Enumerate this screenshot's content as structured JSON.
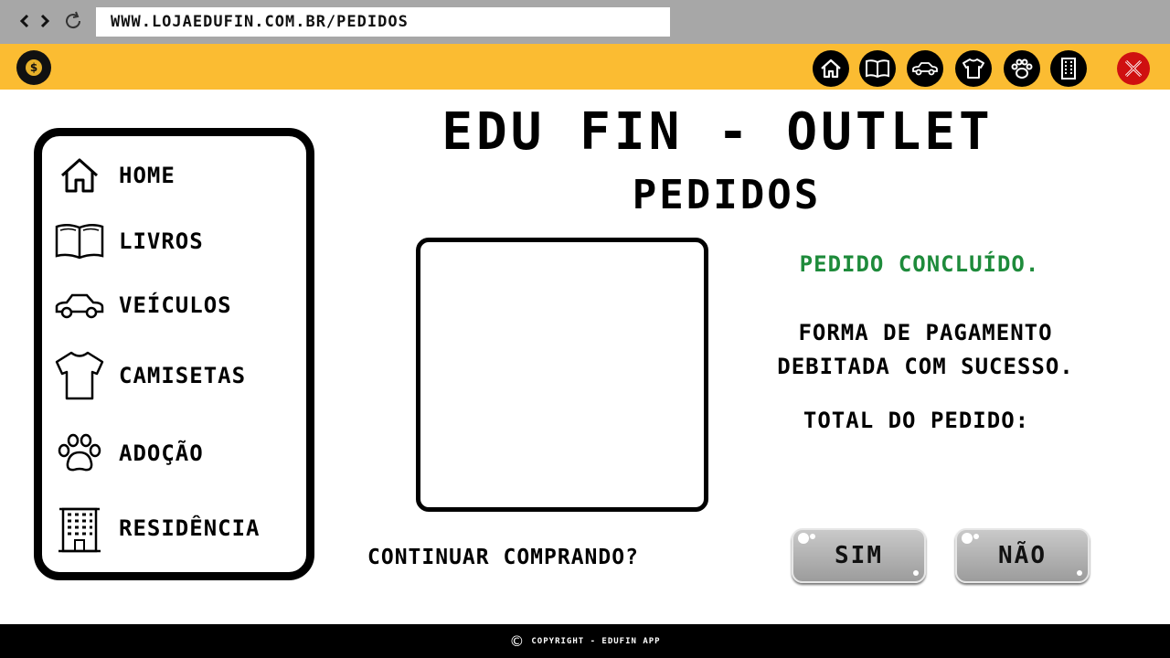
{
  "browser": {
    "url": "WWW.LOJAEDUFIN.COM.BR/PEDIDOS",
    "back_icon": "chevron-left-icon",
    "forward_icon": "chevron-right-icon",
    "reload_icon": "reload-icon"
  },
  "header": {
    "logo_symbol": "$",
    "top_icons": [
      "home-icon",
      "book-icon",
      "car-icon",
      "shirt-icon",
      "paw-icon",
      "building-icon"
    ],
    "close_icon": "close-icon",
    "accent_color": "#fbbc32",
    "close_color": "#cf1010"
  },
  "sidebar": {
    "items": [
      {
        "label": "HOME",
        "icon": "home-icon"
      },
      {
        "label": "LIVROS",
        "icon": "book-icon"
      },
      {
        "label": "VEÍCULOS",
        "icon": "car-icon"
      },
      {
        "label": "CAMISETAS",
        "icon": "shirt-icon"
      },
      {
        "label": "ADOÇÃO",
        "icon": "paw-icon"
      },
      {
        "label": "RESIDÊNCIA",
        "icon": "building-icon"
      }
    ]
  },
  "main": {
    "title": "EDU FIN - OUTLET",
    "subtitle": "PEDIDOS",
    "status": "PEDIDO CONCLUÍDO.",
    "status_color": "#1e8b3b",
    "payment_line1": "FORMA DE PAGAMENTO",
    "payment_line2": "DEBITADA COM SUCESSO.",
    "total_label": "TOTAL DO PEDIDO:",
    "continue_prompt": "CONTINUAR COMPRANDO?",
    "yes_label": "SIM",
    "no_label": "NÃO"
  },
  "footer": {
    "copyright_symbol": "©",
    "text": "COPYRIGHT - EDUFIN APP"
  }
}
